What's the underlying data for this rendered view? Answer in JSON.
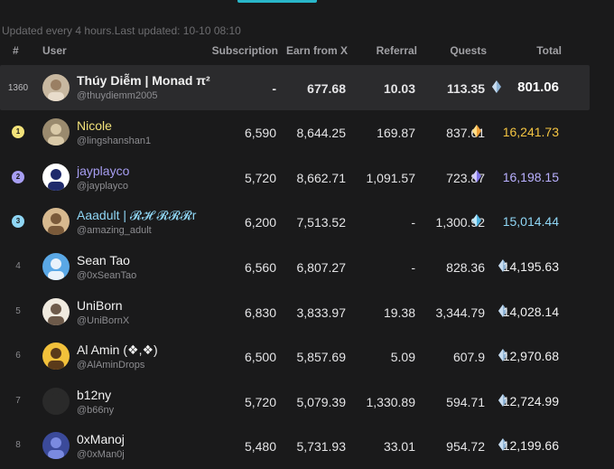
{
  "update_note": "Updated every 4 hours.Last updated: 10-10 08:10",
  "columns": {
    "rank": "#",
    "user": "User",
    "subscription": "Subscription",
    "earn": "Earn from X",
    "referral": "Referral",
    "quests": "Quests",
    "total": "Total"
  },
  "me": {
    "rank": "1360",
    "name": "Thúy Diễm | Monad π²",
    "handle": "@thuydiemm2005",
    "subscription": "-",
    "earn": "677.68",
    "referral": "10.03",
    "quests": "113.35",
    "total": "801.06"
  },
  "rows": [
    {
      "rank": "1",
      "name": "Nicole",
      "handle": "@lingshanshan1",
      "subscription": "6,590",
      "earn": "8,644.25",
      "referral": "169.87",
      "quests": "837.61",
      "total": "16,241.73"
    },
    {
      "rank": "2",
      "name": "jayplayco",
      "handle": "@jayplayco",
      "subscription": "5,720",
      "earn": "8,662.71",
      "referral": "1,091.57",
      "quests": "723.87",
      "total": "16,198.15"
    },
    {
      "rank": "3",
      "name": "Aaadult | 𝓡𝓗 𝓡𝓡𝓡r",
      "handle": "@amazing_adult",
      "subscription": "6,200",
      "earn": "7,513.52",
      "referral": "-",
      "quests": "1,300.92",
      "total": "15,014.44"
    },
    {
      "rank": "4",
      "name": "Sean Tao",
      "handle": "@0xSeanTao",
      "subscription": "6,560",
      "earn": "6,807.27",
      "referral": "-",
      "quests": "828.36",
      "total": "14,195.63"
    },
    {
      "rank": "5",
      "name": "UniBorn",
      "handle": "@UniBornX",
      "subscription": "6,830",
      "earn": "3,833.97",
      "referral": "19.38",
      "quests": "3,344.79",
      "total": "14,028.14"
    },
    {
      "rank": "6",
      "name": "Al Amin (❖,❖)",
      "handle": "@AlAminDrops",
      "subscription": "6,500",
      "earn": "5,857.69",
      "referral": "5.09",
      "quests": "607.9",
      "total": "12,970.68"
    },
    {
      "rank": "7",
      "name": "b12ny",
      "handle": "@b66ny",
      "subscription": "5,720",
      "earn": "5,079.39",
      "referral": "1,330.89",
      "quests": "594.71",
      "total": "12,724.99"
    },
    {
      "rank": "8",
      "name": "0xManoj",
      "handle": "@0xMan0j",
      "subscription": "5,480",
      "earn": "5,731.93",
      "referral": "33.01",
      "quests": "954.72",
      "total": "12,199.66"
    }
  ],
  "colors": {
    "rank1": "#f2e27a",
    "rank2": "#a79ef2",
    "rank3": "#8fd6f5",
    "total1": "#f5c542",
    "total2": "#b9b0ff",
    "total3": "#8fd6f5",
    "accent": "#29b6c9"
  },
  "icons": {
    "total_marker": "diamond-icon"
  }
}
